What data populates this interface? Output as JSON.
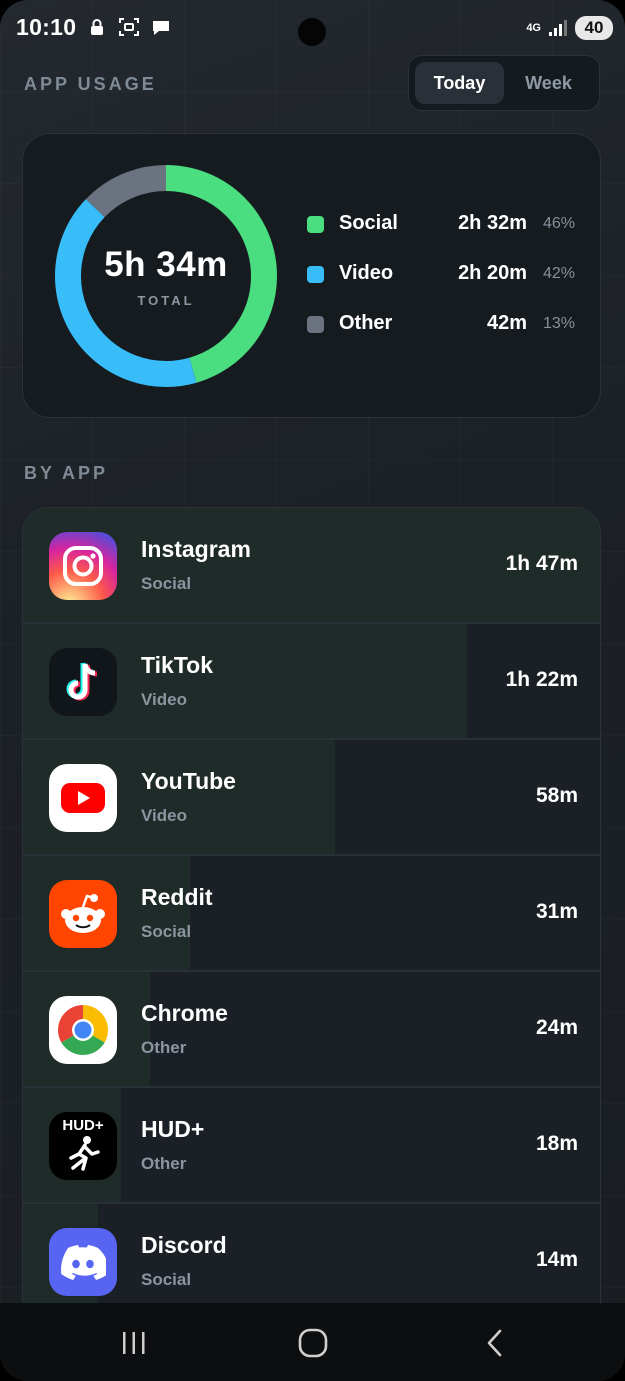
{
  "status_bar": {
    "time": "10:10",
    "network": "4G",
    "battery": "40",
    "icons": [
      "lock-icon",
      "screenshot-icon",
      "chat-bubble-icon",
      "signal-icon"
    ]
  },
  "header": {
    "title": "APP USAGE",
    "toggle": {
      "options": [
        "Today",
        "Week"
      ],
      "selected": "Today"
    }
  },
  "summary": {
    "total_value": "5h 34m",
    "total_label": "TOTAL",
    "categories": [
      {
        "name": "Social",
        "time": "2h 32m",
        "pct": "46%",
        "fraction": 0.46,
        "color": "#4ade80"
      },
      {
        "name": "Video",
        "time": "2h 20m",
        "pct": "42%",
        "fraction": 0.42,
        "color": "#38bdf8"
      },
      {
        "name": "Other",
        "time": "42m",
        "pct": "13%",
        "fraction": 0.13,
        "color": "#6b7280"
      }
    ]
  },
  "by_app": {
    "title": "BY APP",
    "apps": [
      {
        "name": "Instagram",
        "category": "Social",
        "time": "1h 47m",
        "share": 1.0,
        "icon": "instagram-icon"
      },
      {
        "name": "TikTok",
        "category": "Video",
        "time": "1h 22m",
        "share": 0.77,
        "icon": "tiktok-icon"
      },
      {
        "name": "YouTube",
        "category": "Video",
        "time": "58m",
        "share": 0.54,
        "icon": "youtube-icon"
      },
      {
        "name": "Reddit",
        "category": "Social",
        "time": "31m",
        "share": 0.29,
        "icon": "reddit-icon"
      },
      {
        "name": "Chrome",
        "category": "Other",
        "time": "24m",
        "share": 0.22,
        "icon": "chrome-icon"
      },
      {
        "name": "HUD+",
        "category": "Other",
        "time": "18m",
        "share": 0.17,
        "icon": "hud-plus-icon",
        "icon_text": "HUD+"
      },
      {
        "name": "Discord",
        "category": "Social",
        "time": "14m",
        "share": 0.13,
        "icon": "discord-icon"
      }
    ]
  },
  "nav": {
    "buttons": [
      "recent-apps-icon",
      "home-icon",
      "back-icon"
    ]
  }
}
